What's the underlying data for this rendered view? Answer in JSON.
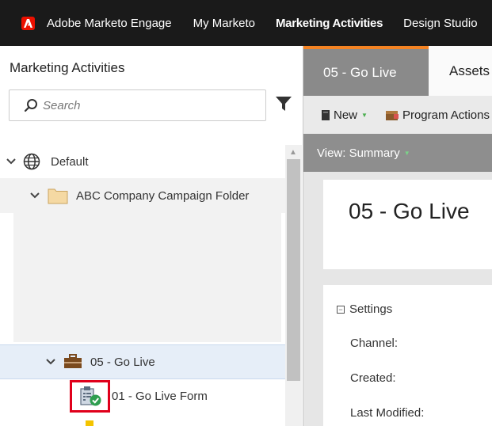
{
  "topbar": {
    "brand": "Adobe Marketo Engage",
    "nav": [
      "My Marketo",
      "Marketing Activities",
      "Design Studio"
    ]
  },
  "left": {
    "title": "Marketing Activities",
    "search_placeholder": "Search",
    "tree": {
      "default": "Default",
      "folder": "ABC Company Campaign Folder",
      "program": "05 - Go Live",
      "form": "01 - Go Live Form"
    }
  },
  "right": {
    "tabs": [
      "05 - Go Live",
      "Assets"
    ],
    "toolbar": {
      "new_label": "New",
      "program_actions_label": "Program Actions"
    },
    "view_label": "View: Summary",
    "program_title": "05 - Go Live",
    "settings": {
      "heading": "Settings",
      "toggle": "−",
      "labels": [
        "Channel:",
        "Created:",
        "Last Modified:"
      ]
    }
  },
  "colors": {
    "accent_orange": "#f48323",
    "highlight_red": "#e0001b",
    "adobe_red": "#eb1000"
  }
}
